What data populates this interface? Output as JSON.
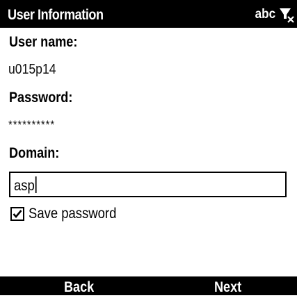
{
  "title_bar": {
    "title": "User Information",
    "input_mode": "abc",
    "signal_icon": "no-signal-icon"
  },
  "form": {
    "username_label": "User name:",
    "username_value": "u015p14",
    "password_label": "Password:",
    "password_value": "**********",
    "domain_label": "Domain:",
    "domain_value": "asp",
    "save_password_label": "Save password",
    "save_password_checked": true
  },
  "softkeys": {
    "left": "Back",
    "right": "Next"
  }
}
